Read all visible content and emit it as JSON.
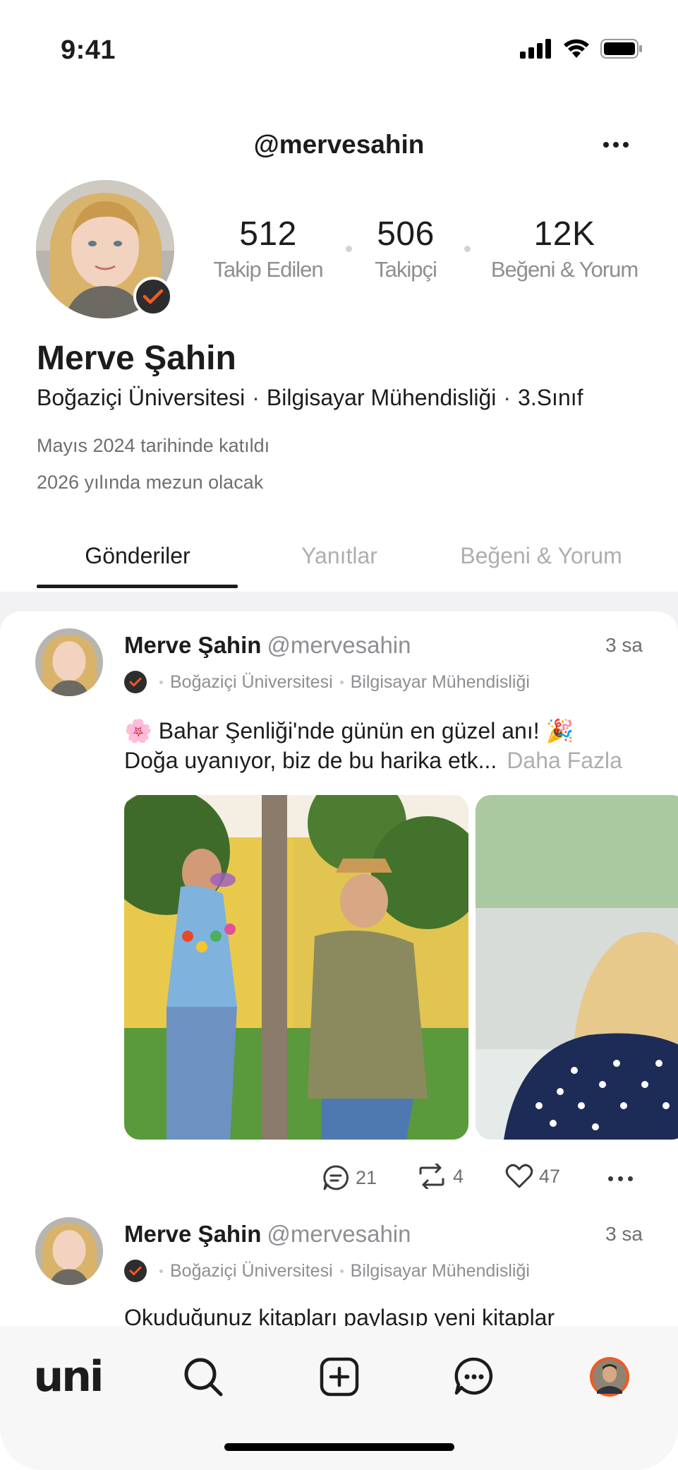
{
  "status_bar": {
    "time": "9:41"
  },
  "header": {
    "handle": "@mervesahin"
  },
  "profile": {
    "name": "Merve Şahin",
    "university": "Boğaziçi Üniversitesi",
    "department": "Bilgisayar Mühendisliği",
    "year": "3.Sınıf",
    "separator": "·",
    "joined": "Mayıs 2024 tarihinde katıldı",
    "graduation": "2026 yılında mezun olacak"
  },
  "stats": [
    {
      "value": "512",
      "label": "Takip Edilen"
    },
    {
      "value": "506",
      "label": "Takipçi"
    },
    {
      "value": "12K",
      "label": "Beğeni & Yorum"
    }
  ],
  "tabs": [
    {
      "label": "Gönderiler",
      "active": true
    },
    {
      "label": "Yanıtlar",
      "active": false
    },
    {
      "label": "Beğeni & Yorum",
      "active": false
    }
  ],
  "posts": [
    {
      "author": "Merve Şahin",
      "handle": "@mervesahin",
      "time": "3 sa",
      "university": "Boğaziçi Üniversitesi",
      "department": "Bilgisayar Mühendisliği",
      "text_line1": "🌸 Bahar Şenliği'nde günün en güzel anı! 🎉",
      "text_line2": "Doğa uyanıyor, biz de bu harika etk...",
      "more": "Daha Fazla",
      "comments": "21",
      "reposts": "4",
      "likes": "47"
    },
    {
      "author": "Merve Şahin",
      "handle": "@mervesahin",
      "time": "3 sa",
      "university": "Boğaziçi Üniversitesi",
      "department": "Bilgisayar Mühendisliği",
      "text_line1": "Okuduğunuz kitapları paylaşıp yeni kitaplar"
    }
  ],
  "bottom_nav": {
    "logo": "uni"
  },
  "colors": {
    "accent": "#f05a22",
    "badge_bg": "#2d2d2f",
    "muted": "#8e8e93"
  },
  "icons": [
    "signal-icon",
    "wifi-icon",
    "battery-icon",
    "more-icon",
    "verified-check-icon",
    "comment-icon",
    "repost-icon",
    "heart-icon",
    "search-icon",
    "add-post-icon",
    "messages-icon"
  ]
}
